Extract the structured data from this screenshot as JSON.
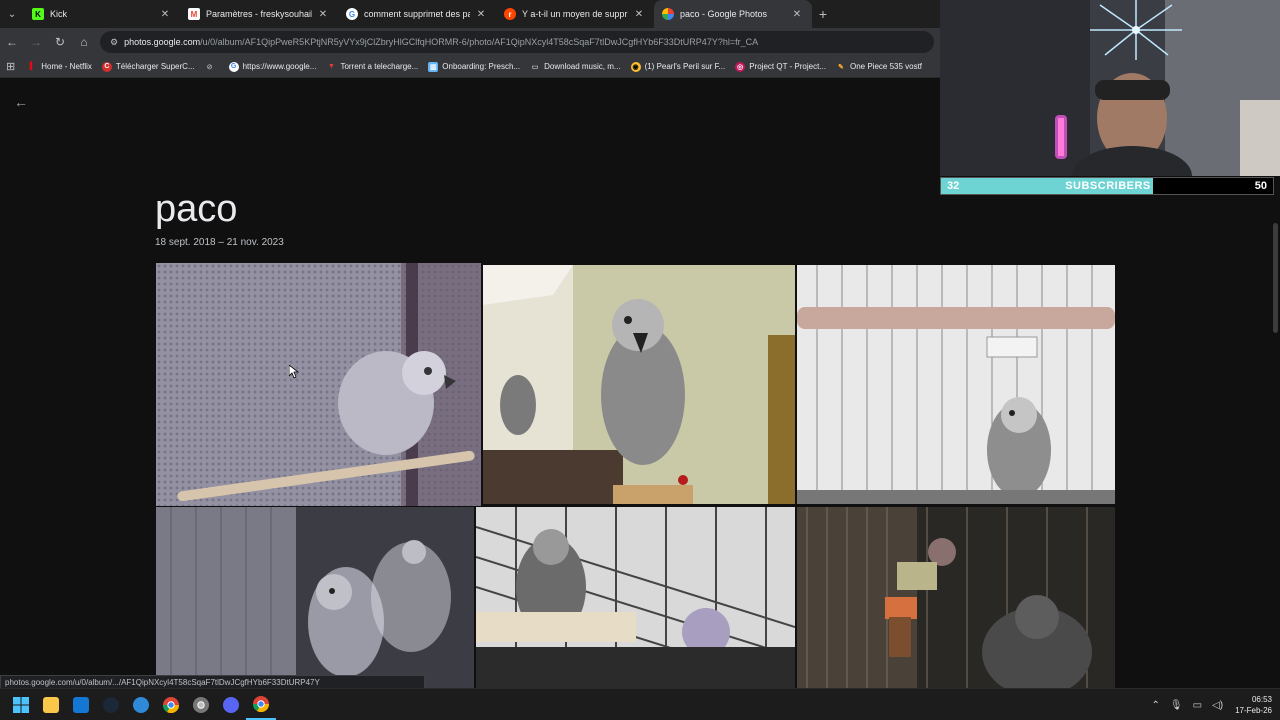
{
  "browser": {
    "tabs": [
      {
        "title": "Kick",
        "icon": "kick-icon",
        "color": "#53fc18",
        "active": false
      },
      {
        "title": "Paramètres - freskysouhaib@gm",
        "icon": "gmail-icon",
        "color": "#ea4335",
        "active": false
      },
      {
        "title": "comment supprimet des pages",
        "icon": "google-icon",
        "color": "#4285f4",
        "active": false
      },
      {
        "title": "Y a-t-il un moyen de supprimer",
        "icon": "reddit-icon",
        "color": "#ff4500",
        "active": false
      },
      {
        "title": "paco - Google Photos",
        "icon": "google-photos-icon",
        "color": "#fbbc04",
        "active": true
      }
    ],
    "url_host": "photos.google.com",
    "url_path": "/u/0/album/AF1QipPweR5KPtjNR5yVYx9jClZbryHlGClfqHORMR-6/photo/AF1QipNXcyl4T58cSqaF7tlDwJCgfHYb6F33DtURP47Y?hl=fr_CA",
    "bookmarks": [
      {
        "label": "Home - Netflix",
        "icon": "netflix-icon",
        "color": "#e50914"
      },
      {
        "label": "Télécharger SuperC...",
        "icon": "c-icon",
        "color": "#d32f2f"
      },
      {
        "label": "",
        "icon": "globe-icon",
        "color": "#9aa0a6"
      },
      {
        "label": "https://www.google...",
        "icon": "google-icon",
        "color": "#4285f4"
      },
      {
        "label": "Torrent a telecharge...",
        "icon": "torrent-icon",
        "color": "#e53935"
      },
      {
        "label": "Onboarding: Presch...",
        "icon": "onboarding-icon",
        "color": "#64b5f6"
      },
      {
        "label": "Download music, m...",
        "icon": "monitor-icon",
        "color": "#bdbdbd"
      },
      {
        "label": "(1) Pearl's Peril sur F...",
        "icon": "pearl-icon",
        "color": "#fbc02d"
      },
      {
        "label": "Project QT - Project...",
        "icon": "qt-icon",
        "color": "#c2185b"
      },
      {
        "label": "One Piece 535 vostf",
        "icon": "pen-icon",
        "color": "#f9a825"
      }
    ],
    "status_url": "photos.google.com/u/0/album/.../AF1QipNXcyl4T58cSqaF7tlDwJCgfHYb6F33DtURP47Y"
  },
  "album": {
    "title": "paco",
    "dates": "18 sept. 2018 – 21 nov. 2023"
  },
  "subscribers": {
    "current": "32",
    "label": "SUBSCRIBERS",
    "goal": "50",
    "fraction": 0.64
  },
  "taskbar": {
    "apps": [
      "windows-start-icon",
      "file-explorer-icon",
      "outlook-icon",
      "steam-icon",
      "edge-icon",
      "chrome-icon",
      "chrome-dev-icon",
      "discord-icon",
      "chrome-active-icon"
    ],
    "time": "06:53",
    "date": "17-Feb-26"
  }
}
